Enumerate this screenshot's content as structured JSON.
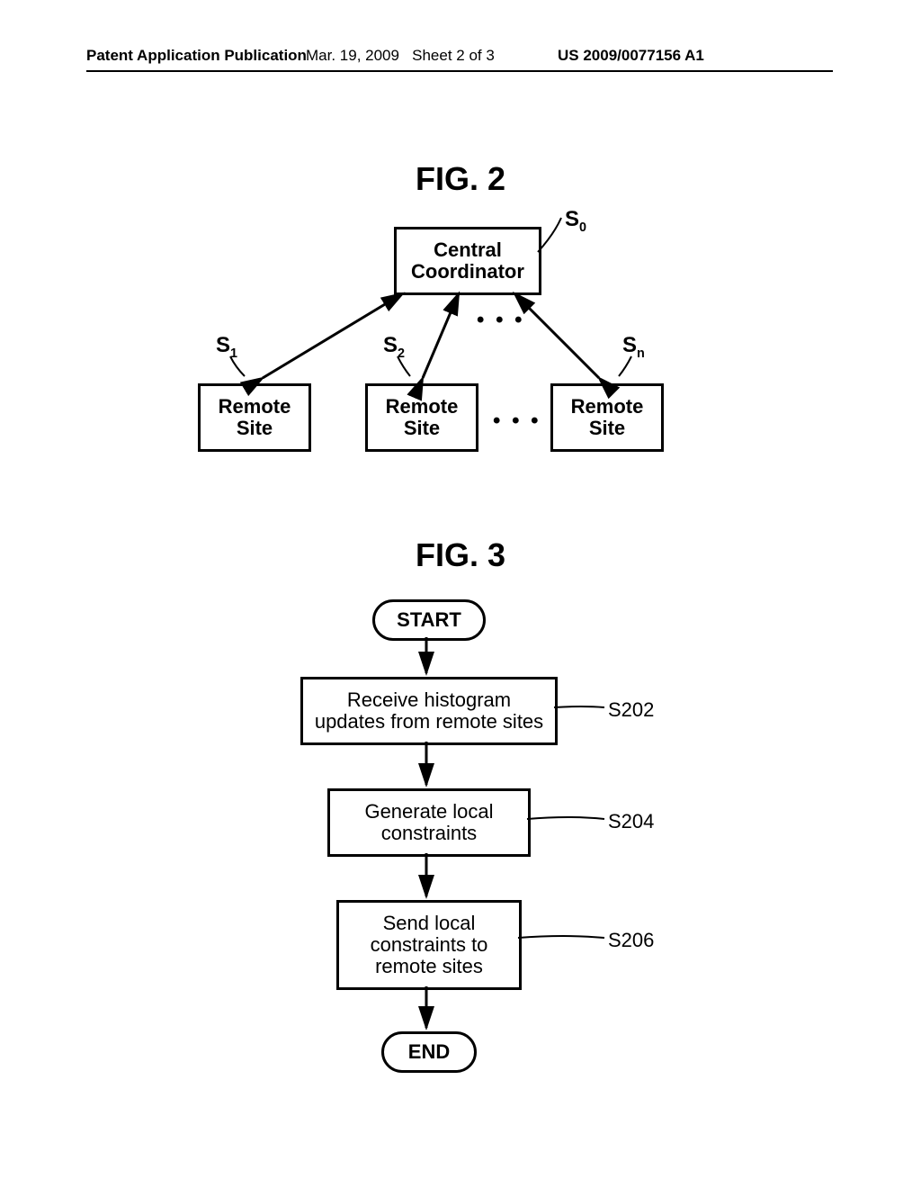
{
  "header": {
    "left": "Patent Application Publication",
    "date": "Mar. 19, 2009",
    "sheet": "Sheet 2 of 3",
    "number": "US 2009/0077156 A1"
  },
  "fig2": {
    "title": "FIG. 2",
    "central": "Central\nCoordinator",
    "central_label": "S",
    "central_sub": "0",
    "sites": [
      {
        "label": "S",
        "sub": "1",
        "text": "Remote\nSite"
      },
      {
        "label": "S",
        "sub": "2",
        "text": "Remote\nSite"
      },
      {
        "label": "S",
        "sub": "n",
        "text": "Remote\nSite"
      }
    ],
    "dots": "• • •"
  },
  "fig3": {
    "title": "FIG. 3",
    "start": "START",
    "end": "END",
    "steps": [
      {
        "text": "Receive histogram\nupdates from remote sites",
        "label": "S202"
      },
      {
        "text": "Generate local\nconstraints",
        "label": "S204"
      },
      {
        "text": "Send local\nconstraints to\nremote sites",
        "label": "S206"
      }
    ]
  }
}
